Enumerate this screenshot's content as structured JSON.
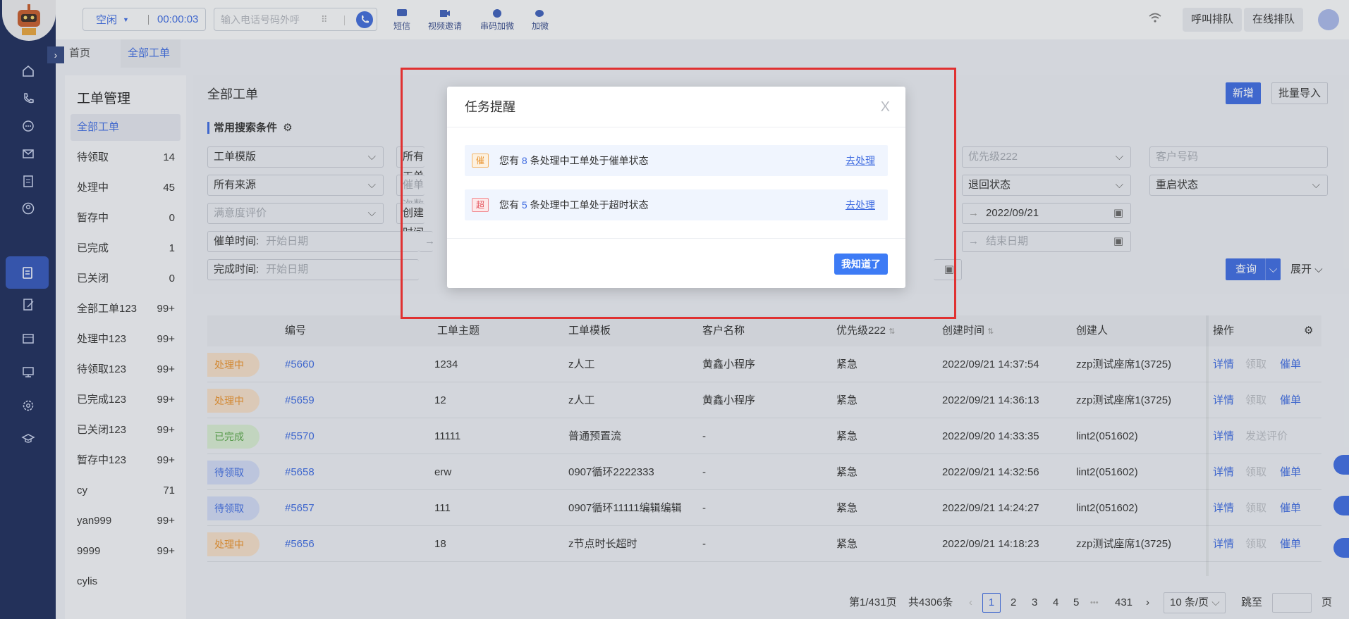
{
  "topbar": {
    "status_label": "空闲",
    "timer": "00:00:03",
    "dial_placeholder": "输入电话号码外呼",
    "tools": [
      "短信",
      "视频邀请",
      "串码加微",
      "加微"
    ],
    "queue_call": "呼叫排队",
    "queue_online": "在线排队"
  },
  "tabs": {
    "home": "首页",
    "current": "全部工单",
    "close": "×"
  },
  "sidebar": {
    "title": "工单管理",
    "items": [
      {
        "label": "全部工单",
        "count": ""
      },
      {
        "label": "待领取",
        "count": "14"
      },
      {
        "label": "处理中",
        "count": "45"
      },
      {
        "label": "暂存中",
        "count": "0"
      },
      {
        "label": "已完成",
        "count": "1"
      },
      {
        "label": "已关闭",
        "count": "0"
      },
      {
        "label": "全部工单123",
        "count": "99+"
      },
      {
        "label": "处理中123",
        "count": "99+"
      },
      {
        "label": "待领取123",
        "count": "99+"
      },
      {
        "label": "已完成123",
        "count": "99+"
      },
      {
        "label": "已关闭123",
        "count": "99+"
      },
      {
        "label": "暂存中123",
        "count": "99+"
      },
      {
        "label": "cy",
        "count": "71"
      },
      {
        "label": "yan999",
        "count": "99+"
      },
      {
        "label": "9999",
        "count": "99+"
      },
      {
        "label": "cylis",
        "count": ""
      }
    ]
  },
  "main": {
    "title": "全部工单",
    "btn_add": "新增",
    "btn_import": "批量导入",
    "search_title": "常用搜索条件",
    "filters": {
      "template": "工单模版",
      "all_templates": "所有工单",
      "priority": "优先级222",
      "customer_no": "客户号码",
      "all_sources": "所有来源",
      "urge_count": "催单次数",
      "return_state": "退回状态",
      "restart_state": "重启状态",
      "satisfaction": "满意度评价",
      "create_time": "创建时间",
      "date_end_value": "2022/09/21",
      "urge_time": "催单时间:",
      "finish_time": "完成时间:",
      "start_date": "开始日期",
      "end_date": "结束日期",
      "end_date_short": "结束",
      "arrow": "→"
    },
    "btn_query": "查询",
    "btn_expand": "展开"
  },
  "table": {
    "headers": [
      "编号",
      "工单主题",
      "工单模板",
      "客户名称",
      "优先级222",
      "创建时间",
      "创建人",
      "操作"
    ],
    "rows": [
      {
        "status": "处理中",
        "id": "#5660",
        "subject": "1234",
        "template": "z人工",
        "customer": "黄鑫小程序",
        "priority": "紧急",
        "time": "2022/09/21 14:37:54",
        "creator": "zzp测试座席1(3725)",
        "a1": "详情",
        "a2": "领取",
        "a3": "催单"
      },
      {
        "status": "处理中",
        "id": "#5659",
        "subject": "12",
        "template": "z人工",
        "customer": "黄鑫小程序",
        "priority": "紧急",
        "time": "2022/09/21 14:36:13",
        "creator": "zzp测试座席1(3725)",
        "a1": "详情",
        "a2": "领取",
        "a3": "催单"
      },
      {
        "status": "已完成",
        "id": "#5570",
        "subject": "11111",
        "template": "普通预置流",
        "customer": "-",
        "priority": "紧急",
        "time": "2022/09/20 14:33:35",
        "creator": "lint2(051602)",
        "a1": "详情",
        "a2": "发送评价",
        "a3": ""
      },
      {
        "status": "待领取",
        "id": "#5658",
        "subject": "erw",
        "template": "0907循环2222333",
        "customer": "-",
        "priority": "紧急",
        "time": "2022/09/21 14:32:56",
        "creator": "lint2(051602)",
        "a1": "详情",
        "a2": "领取",
        "a3": "催单"
      },
      {
        "status": "待领取",
        "id": "#5657",
        "subject": "111",
        "template": "0907循环11111编辑编辑",
        "customer": "-",
        "priority": "紧急",
        "time": "2022/09/21 14:24:27",
        "creator": "lint2(051602)",
        "a1": "详情",
        "a2": "领取",
        "a3": "催单"
      },
      {
        "status": "处理中",
        "id": "#5656",
        "subject": "18",
        "template": "z节点时长超时",
        "customer": "-",
        "priority": "紧急",
        "time": "2022/09/21 14:18:23",
        "creator": "zzp测试座席1(3725)",
        "a1": "详情",
        "a2": "领取",
        "a3": "催单"
      }
    ]
  },
  "pager": {
    "info": "第1/431页",
    "total": "共4306条",
    "pages": [
      "1",
      "2",
      "3",
      "4",
      "5",
      "431"
    ],
    "ellipsis": "•••",
    "per_page": "10 条/页",
    "jump": "跳至",
    "page_suffix": "页"
  },
  "modal": {
    "title": "任务提醒",
    "close": "X",
    "n1_badge": "催",
    "n1_prefix": "您有",
    "n1_count": "8",
    "n1_suffix": "条处理中工单处于催单状态",
    "n1_link": "去处理",
    "n2_badge": "超",
    "n2_prefix": "您有",
    "n2_count": "5",
    "n2_suffix": "条处理中工单处于超时状态",
    "n2_link": "去处理",
    "ok": "我知道了"
  },
  "colors": {
    "accent": "#3d6ae0",
    "nav_bg": "#1d2c5a",
    "highlight_box": "#e03131",
    "ok_button": "#3d7bf5"
  }
}
